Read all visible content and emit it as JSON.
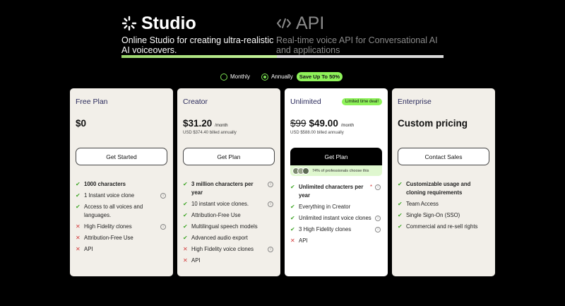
{
  "products": {
    "studio": {
      "title": "Studio",
      "description": "Online Studio for creating ultra-realistic AI voiceovers."
    },
    "api": {
      "title": "API",
      "description": "Real-time voice API for Conversational AI and applications"
    }
  },
  "billing": {
    "monthly_label": "Monthly",
    "annually_label": "Annually",
    "save_badge": "Save Up To 50%",
    "selected": "Annually"
  },
  "plans": [
    {
      "name": "Free Plan",
      "price": "$0",
      "cta": "Get Started",
      "features": [
        {
          "mark": "check",
          "text": "1000 characters",
          "bold": true,
          "info": false
        },
        {
          "mark": "check",
          "text": "1 Instant voice clone",
          "bold": false,
          "info": true
        },
        {
          "mark": "check",
          "text": "Access to all voices and languages.",
          "bold": false,
          "info": false
        },
        {
          "mark": "cross",
          "text": "High Fidelity clones",
          "bold": false,
          "info": true
        },
        {
          "mark": "cross",
          "text": "Attribution-Free Use",
          "bold": false,
          "info": false
        },
        {
          "mark": "cross",
          "text": "API",
          "bold": false,
          "info": false
        }
      ]
    },
    {
      "name": "Creator",
      "price": "$31.20",
      "per": "/month",
      "billed": "USD $374.40 billed annually",
      "cta": "Get Plan",
      "features": [
        {
          "mark": "check",
          "text": "3 million characters per year",
          "bold": true,
          "info": true
        },
        {
          "mark": "check",
          "text": "10 instant voice clones.",
          "bold": false,
          "info": true
        },
        {
          "mark": "check",
          "text": "Attribution-Free Use",
          "bold": false,
          "info": false
        },
        {
          "mark": "check",
          "text": "Multilingual speech models",
          "bold": false,
          "info": false
        },
        {
          "mark": "check",
          "text": "Advanced audio export",
          "bold": false,
          "info": false
        },
        {
          "mark": "cross",
          "text": "High Fidelity voice clones",
          "bold": false,
          "info": true
        },
        {
          "mark": "cross",
          "text": "API",
          "bold": false,
          "info": false
        }
      ]
    },
    {
      "name": "Unlimited",
      "badge": "Limited time deal!",
      "price_old": "$99",
      "price": "$49.00",
      "per": "/month",
      "billed": "USD $588.00 billed annually",
      "cta": "Get Plan",
      "social_proof": "74% of professionals choose this",
      "features": [
        {
          "mark": "check",
          "text": "Unlimited characters per year",
          "bold": true,
          "info": true,
          "required": "*"
        },
        {
          "mark": "check",
          "text": "Everything in Creator",
          "bold": false,
          "info": false
        },
        {
          "mark": "check",
          "text": "Unlimited instant voice clones",
          "bold": false,
          "info": true
        },
        {
          "mark": "check",
          "text": "3 High Fidelity clones",
          "bold": false,
          "info": true
        },
        {
          "mark": "cross",
          "text": "API",
          "bold": false,
          "info": false
        }
      ]
    },
    {
      "name": "Enterprise",
      "price": "Custom pricing",
      "cta": "Contact Sales",
      "features": [
        {
          "mark": "check",
          "text": "Customizable usage and cloning requirements",
          "bold": true,
          "info": false
        },
        {
          "mark": "check",
          "text": "Team Access",
          "bold": false,
          "info": false
        },
        {
          "mark": "check",
          "text": "Single Sign-On (SSO)",
          "bold": false,
          "info": false
        },
        {
          "mark": "check",
          "text": "Commercial and re-sell rights",
          "bold": false,
          "info": false
        }
      ]
    }
  ],
  "icons": {
    "studio": "loader-spark-icon",
    "api": "code-brackets-icon",
    "check": "check-icon",
    "cross": "cross-icon",
    "info": "info-icon"
  },
  "colors": {
    "accent_green": "#8ef25a",
    "check_green": "#43a82b",
    "cross_red": "#d23b3b",
    "card_bg": "#f2efe9"
  }
}
